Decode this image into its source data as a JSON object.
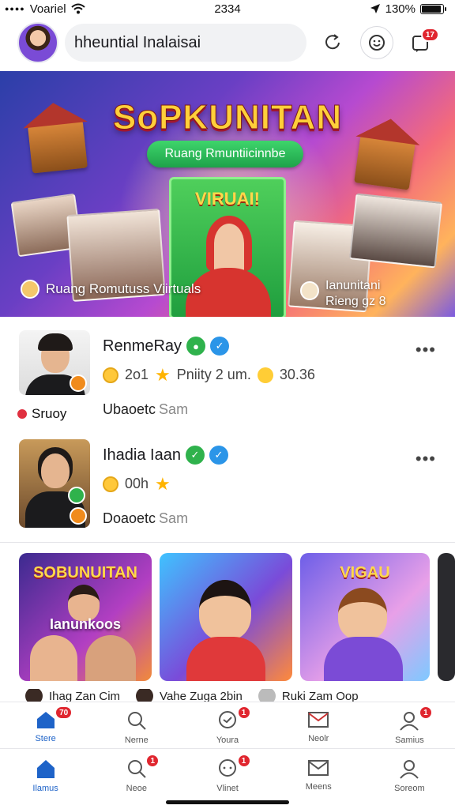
{
  "status_bar": {
    "carrier": "Voariel",
    "time": "2334",
    "battery": "130%",
    "battery_level": 0.85
  },
  "header": {
    "search_text": "hheuntial Inalaisai",
    "icons": [
      "refresh-icon",
      "emoji-icon",
      "notifications-icon"
    ],
    "notification_badge": "17"
  },
  "banner": {
    "title": "SoPKUNITAN",
    "pill": "Ruang Rmuntiicinnbe",
    "card_title": "VIRUAI!",
    "caption_left": "Ruang Romutuss Viirtuals",
    "caption_right_1": "Ianunitani",
    "caption_right_2": "Rieng gz 8"
  },
  "feed": [
    {
      "name": "RenmeRay",
      "stat_1": "2o1",
      "stat_2": "Pniity 2 um.",
      "stat_3": "30.36",
      "subtitle": "Ubaoetc",
      "subtitle_muted": "Sam",
      "tag": "Sruoy"
    },
    {
      "name": "Ihadia Iaan",
      "stat_1": "00h",
      "subtitle": "Doaoetc",
      "subtitle_muted": "Sam"
    }
  ],
  "cards": [
    {
      "title": "SOBUNUITAN",
      "subtitle": "Ianunkoos"
    },
    {
      "title": ""
    },
    {
      "title": "VIGAU"
    }
  ],
  "peek": [
    "Ihag Zan Cim",
    "Vahe Zuga 2bin",
    "Ruki Zam Oop"
  ],
  "tabbar_one": [
    {
      "label": "Stere",
      "icon": "home-icon",
      "badge": "70"
    },
    {
      "label": "Nerne",
      "icon": "search-icon"
    },
    {
      "label": "Youra",
      "icon": "chat-icon",
      "badge": "1"
    },
    {
      "label": "Neolr",
      "icon": "mail-icon"
    },
    {
      "label": "Samius",
      "icon": "profile-icon",
      "badge": "1"
    }
  ],
  "tabbar_two": [
    {
      "label": "Ilamus",
      "icon": "home-icon"
    },
    {
      "label": "Neoe",
      "icon": "search-icon",
      "badge": "1"
    },
    {
      "label": "Vlinet",
      "icon": "chat-icon",
      "badge": "1"
    },
    {
      "label": "Meens",
      "icon": "mail-icon"
    },
    {
      "label": "Soreom",
      "icon": "profile-icon"
    }
  ],
  "colors": {
    "accent": "#1e63c8",
    "badge": "#e0262f",
    "verify_green": "#2fb24c",
    "verify_blue": "#2b95e8"
  }
}
